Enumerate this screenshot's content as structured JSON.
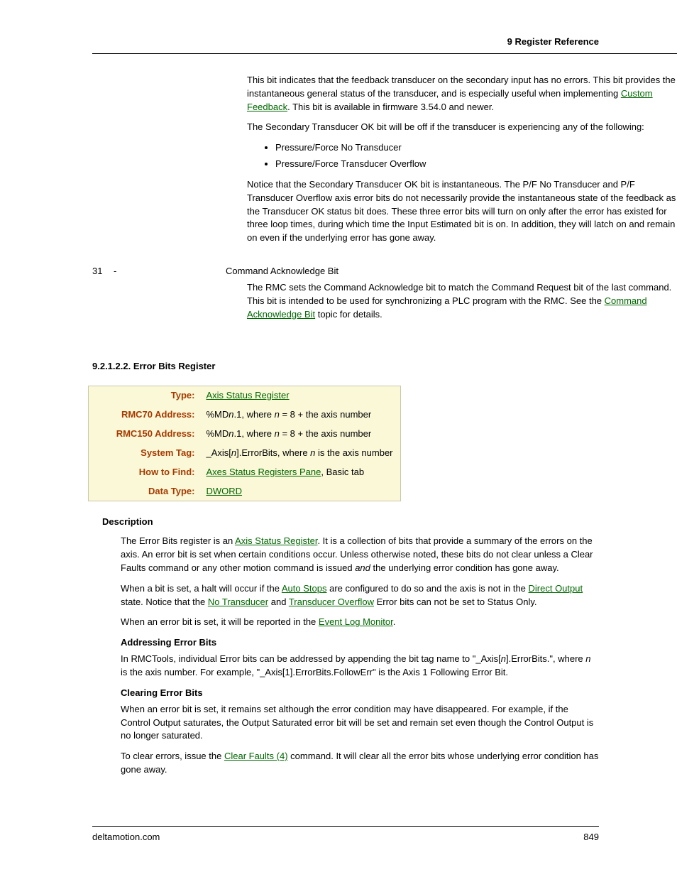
{
  "header": {
    "section": "9  Register Reference"
  },
  "top": {
    "p1a": "This bit indicates that the feedback transducer on the secondary input has no errors. This bit provides the instantaneous general status of the transducer, and is especially useful when implementing ",
    "link1": "Custom Feedback",
    "p1b": ". This bit is available in firmware 3.54.0 and newer.",
    "p2": "The Secondary Transducer OK bit will be off if the transducer is experiencing any of the following:",
    "bullets": [
      "Pressure/Force No Transducer",
      "Pressure/Force Transducer Overflow"
    ],
    "p3": "Notice that the Secondary Transducer OK bit is instantaneous. The P/F No Transducer and P/F Transducer Overflow axis error bits do not necessarily provide the instantaneous state of the feedback as the Transducer OK status bit does. These three error bits will turn on only after the error has existed for three loop times, during which time the Input Estimated bit is on. In addition, they will latch on and remain on even if the underlying error has gone away."
  },
  "bit31": {
    "num": "31",
    "dash": "-",
    "title": "Command Acknowledge Bit",
    "body_a": "The RMC sets the Command Acknowledge bit to match the Command Request bit of the last command. This bit is intended to be used for synchronizing a PLC program with the RMC. See the ",
    "link": "Command Acknowledge Bit",
    "body_b": " topic for details."
  },
  "section_title": "9.2.1.2.2. Error Bits Register",
  "table": {
    "rows": [
      {
        "label": "Type:",
        "link": "Axis Status Register",
        "plain": ""
      },
      {
        "label": "RMC70 Address:",
        "pre": "%MD",
        "it": "n",
        "mid": ".1, where ",
        "it2": "n",
        "post": " = 8 + the axis number"
      },
      {
        "label": "RMC150 Address:",
        "pre": "%MD",
        "it": "n",
        "mid": ".1, where ",
        "it2": "n",
        "post": " = 8 + the axis number"
      },
      {
        "label": "System Tag:",
        "pre": "_Axis[",
        "it": "n",
        "mid": "].ErrorBits, where ",
        "it2": "n",
        "post": " is the axis number"
      },
      {
        "label": "How to Find:",
        "link": "Axes Status Registers Pane",
        "plain": ", Basic tab"
      },
      {
        "label": "Data Type:",
        "link": "DWORD",
        "plain": ""
      }
    ]
  },
  "desc": {
    "head": "Description",
    "p1a": "The Error Bits register is an ",
    "l1": "Axis Status Register",
    "p1b": ". It is a collection of bits that provide a summary of the errors on the axis. An error bit is set when certain conditions occur. Unless otherwise noted, these bits do not clear unless a Clear Faults command or any other motion command is issued ",
    "p1_and": "and",
    "p1c": " the underlying error condition has gone away.",
    "p2a": "When a bit is set, a halt will occur if the ",
    "l2": "Auto Stops",
    "p2b": " are configured to do so and the axis is not in the ",
    "l3": "Direct Output",
    "p2c": " state. Notice that the ",
    "l4": "No Transducer",
    "p2d": " and ",
    "l5": "Transducer Overflow",
    "p2e": " Error bits can not be set to Status Only.",
    "p3a": "When an error bit is set, it will be reported in the ",
    "l6": "Event Log Monitor",
    "p3b": ".",
    "sub1": "Addressing Error Bits",
    "p4a": "In RMCTools, individual Error bits can be addressed by appending the bit tag name to \"_Axis[",
    "p4_it": "n",
    "p4b": "].ErrorBits.\", where ",
    "p4_it2": "n",
    "p4c": " is the axis number. For example, \"_Axis[1].ErrorBits.FollowErr\" is the Axis 1 Following Error Bit.",
    "sub2": "Clearing Error Bits",
    "p5": "When an error bit is set, it remains set although the error condition may have disappeared. For example, if the Control Output saturates, the Output Saturated error bit will be set and remain set even though the Control Output is no longer saturated.",
    "p6a": "To clear errors, issue the ",
    "l7": "Clear Faults (4)",
    "p6b": " command. It will clear all the error bits whose underlying error condition has gone away."
  },
  "footer": {
    "site": "deltamotion.com",
    "page": "849"
  }
}
